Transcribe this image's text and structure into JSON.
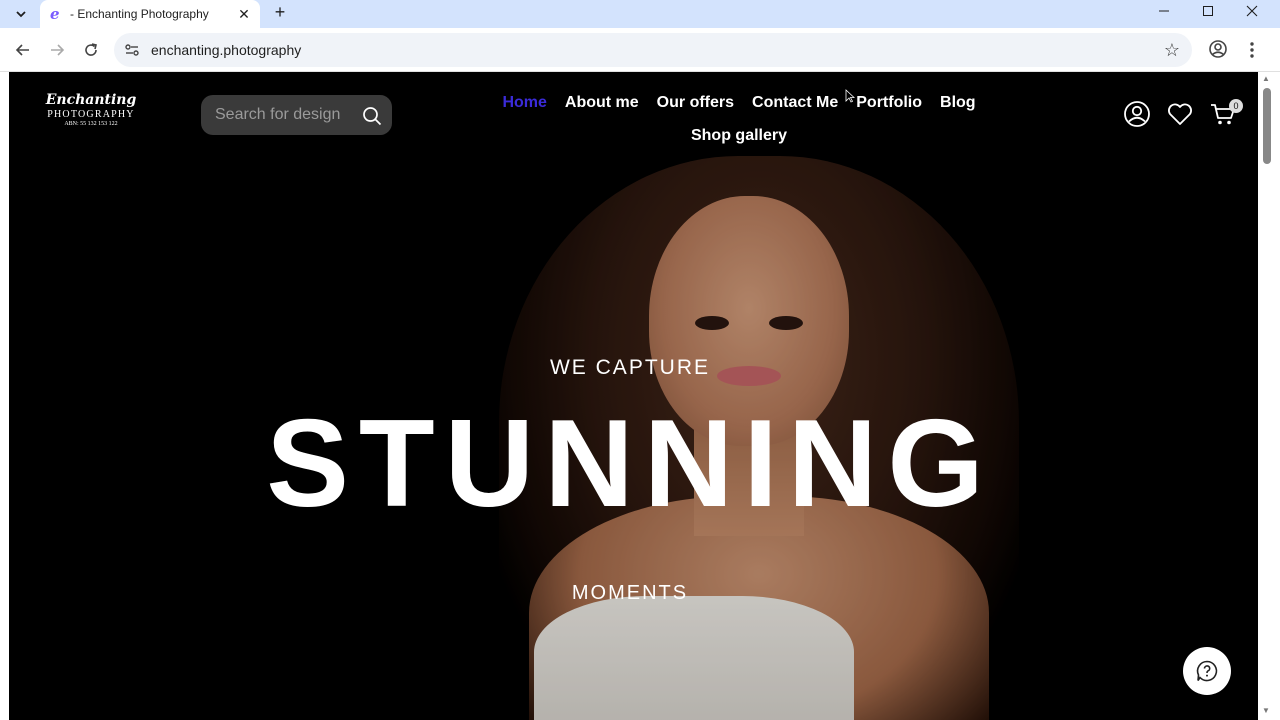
{
  "browser": {
    "tab_title": "- Enchanting Photography",
    "tab_favicon": "e",
    "new_tab": "+",
    "url": "enchanting.photography",
    "icons": [
      "tab-list-icon",
      "close-icon",
      "minimize-icon",
      "maximize-icon",
      "back-icon",
      "forward-icon",
      "reload-icon",
      "site-info-icon",
      "bookmark-star-icon",
      "profile-icon",
      "menu-icon"
    ]
  },
  "site": {
    "logo": {
      "script": "Enchanting",
      "sub": "PHOTOGRAPHY",
      "abn": "ABN: 55 132 153 122"
    },
    "search": {
      "placeholder": "Search for design"
    },
    "nav": {
      "home": "Home",
      "about": "About me",
      "offers": "Our offers",
      "contact": "Contact Me",
      "portfolio": "Portfolio",
      "blog": "Blog",
      "shop": "Shop gallery"
    },
    "cart_count": "0",
    "colors": {
      "active_nav": "#3b2bd9",
      "background": "#000000",
      "search_bg": "#3a3a3a"
    }
  },
  "hero": {
    "kicker": "WE CAPTURE",
    "headline": "STUNNING",
    "sub": "MOMENTS"
  }
}
